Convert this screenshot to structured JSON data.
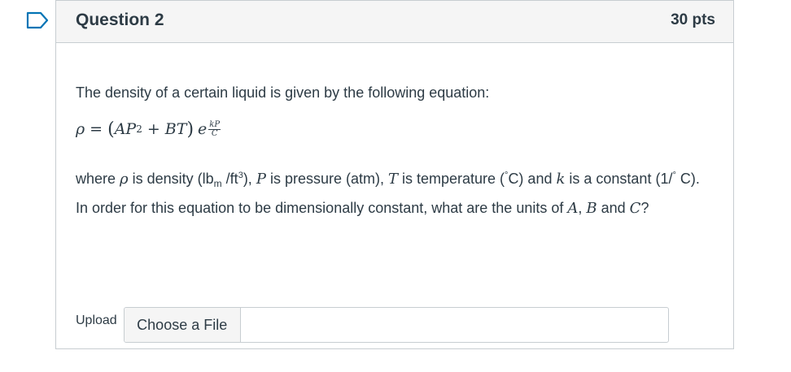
{
  "question": {
    "title": "Question 2",
    "points": "30 pts",
    "flag_icon": "bookmark-flag-icon"
  },
  "body": {
    "intro": "The density of a certain liquid is given by the following equation:",
    "equation": {
      "lhs": "ρ",
      "equals": "=",
      "open_paren": "(",
      "A": "A",
      "P": "P",
      "P_exp": "2",
      "plus": "+",
      "B": "B",
      "T": "T",
      "close_paren": ")",
      "e": "e",
      "exp_num": "kP",
      "exp_den": "C"
    },
    "desc": {
      "p1": "where ",
      "rho": "ρ",
      "p2": " is density (lb",
      "sub_m": "m",
      "p3": " /ft",
      "sup_3": "3",
      "p4": "), ",
      "P": "P",
      "p5": " is pressure (atm), ",
      "T": "T",
      "p6": " is temperature (",
      "deg1": "°",
      "p7": "C) and ",
      "k": "k",
      "p8": "  is a constant (1/",
      "deg2": "°",
      "p9": " C). In order for this equation to be dimensionally constant, what are the units of ",
      "A": "A",
      "comma": ", ",
      "B": "B",
      "and": " and ",
      "C": "C",
      "q": "?"
    }
  },
  "upload": {
    "label": "Upload",
    "button_label": "Choose a File",
    "file_name": ""
  },
  "colors": {
    "accent": "#0374b5",
    "text": "#2d3b45",
    "border": "#c7cdd1",
    "header_bg": "#f5f5f5"
  }
}
